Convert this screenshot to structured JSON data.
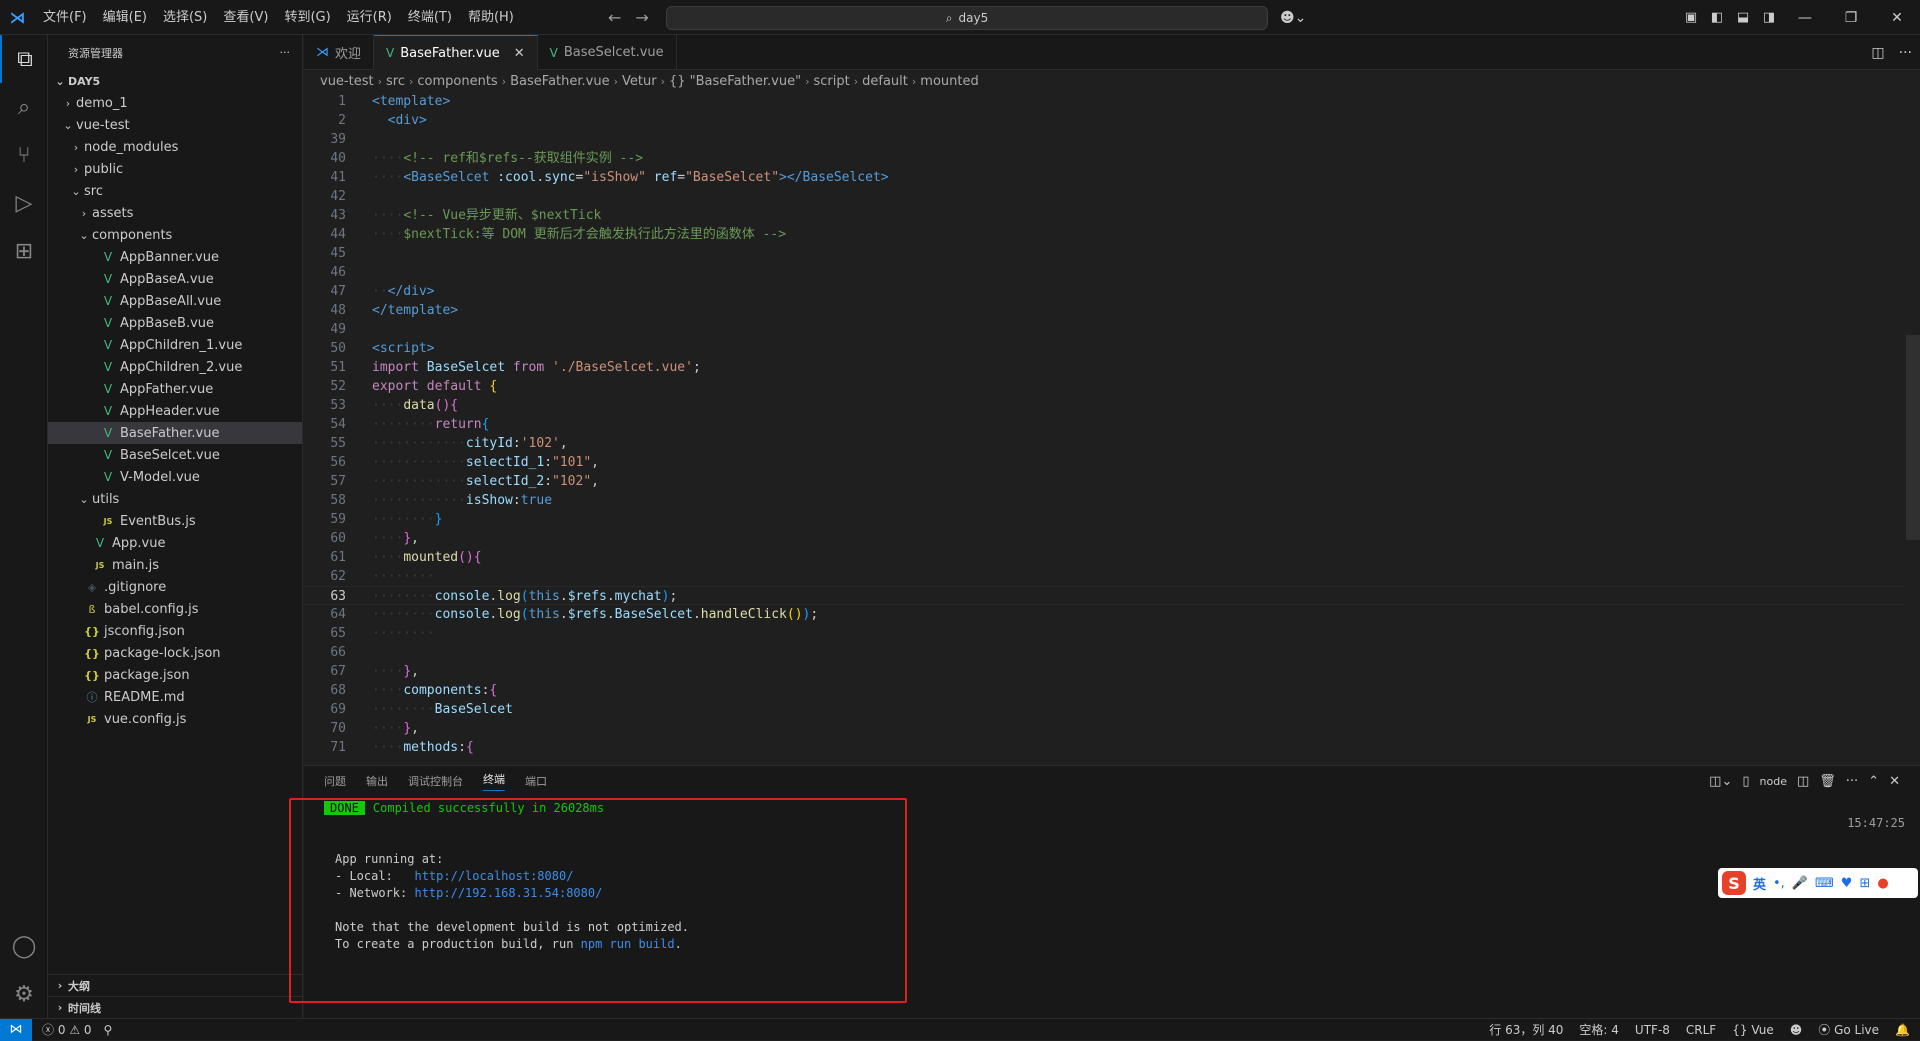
{
  "menu": [
    "文件(F)",
    "编辑(E)",
    "选择(S)",
    "查看(V)",
    "转到(G)",
    "运行(R)",
    "终端(T)",
    "帮助(H)"
  ],
  "search": {
    "text": "day5"
  },
  "sidebar": {
    "title": "资源管理器",
    "root": "DAY5",
    "tree": [
      {
        "label": "demo_1",
        "depth": 1,
        "chev": "›",
        "icon": ""
      },
      {
        "label": "vue-test",
        "depth": 1,
        "chev": "⌄",
        "icon": ""
      },
      {
        "label": "node_modules",
        "depth": 2,
        "chev": "›",
        "icon": ""
      },
      {
        "label": "public",
        "depth": 2,
        "chev": "›",
        "icon": ""
      },
      {
        "label": "src",
        "depth": 2,
        "chev": "⌄",
        "icon": ""
      },
      {
        "label": "assets",
        "depth": 3,
        "chev": "›",
        "icon": ""
      },
      {
        "label": "components",
        "depth": 3,
        "chev": "⌄",
        "icon": ""
      },
      {
        "label": "AppBanner.vue",
        "depth": 4,
        "chev": "",
        "icon": "vue"
      },
      {
        "label": "AppBaseA.vue",
        "depth": 4,
        "chev": "",
        "icon": "vue"
      },
      {
        "label": "AppBaseAll.vue",
        "depth": 4,
        "chev": "",
        "icon": "vue"
      },
      {
        "label": "AppBaseB.vue",
        "depth": 4,
        "chev": "",
        "icon": "vue"
      },
      {
        "label": "AppChildren_1.vue",
        "depth": 4,
        "chev": "",
        "icon": "vue"
      },
      {
        "label": "AppChildren_2.vue",
        "depth": 4,
        "chev": "",
        "icon": "vue"
      },
      {
        "label": "AppFather.vue",
        "depth": 4,
        "chev": "",
        "icon": "vue"
      },
      {
        "label": "AppHeader.vue",
        "depth": 4,
        "chev": "",
        "icon": "vue"
      },
      {
        "label": "BaseFather.vue",
        "depth": 4,
        "chev": "",
        "icon": "vue",
        "selected": true
      },
      {
        "label": "BaseSelcet.vue",
        "depth": 4,
        "chev": "",
        "icon": "vue"
      },
      {
        "label": "V-Model.vue",
        "depth": 4,
        "chev": "",
        "icon": "vue"
      },
      {
        "label": "utils",
        "depth": 3,
        "chev": "⌄",
        "icon": ""
      },
      {
        "label": "EventBus.js",
        "depth": 4,
        "chev": "",
        "icon": "js"
      },
      {
        "label": "App.vue",
        "depth": 3,
        "chev": "",
        "icon": "vue"
      },
      {
        "label": "main.js",
        "depth": 3,
        "chev": "",
        "icon": "js"
      },
      {
        "label": ".gitignore",
        "depth": 2,
        "chev": "",
        "icon": "git"
      },
      {
        "label": "babel.config.js",
        "depth": 2,
        "chev": "",
        "icon": "babel"
      },
      {
        "label": "jsconfig.json",
        "depth": 2,
        "chev": "",
        "icon": "json"
      },
      {
        "label": "package-lock.json",
        "depth": 2,
        "chev": "",
        "icon": "json"
      },
      {
        "label": "package.json",
        "depth": 2,
        "chev": "",
        "icon": "json"
      },
      {
        "label": "README.md",
        "depth": 2,
        "chev": "",
        "icon": "info"
      },
      {
        "label": "vue.config.js",
        "depth": 2,
        "chev": "",
        "icon": "js"
      }
    ],
    "sections": [
      "大纲",
      "时间线"
    ]
  },
  "tabs": [
    {
      "label": "欢迎",
      "icon": "vscode",
      "active": false
    },
    {
      "label": "BaseFather.vue",
      "icon": "vue",
      "active": true
    },
    {
      "label": "BaseSelcet.vue",
      "icon": "vue",
      "active": false
    }
  ],
  "breadcrumb": [
    "vue-test",
    "src",
    "components",
    "BaseFather.vue",
    "Vetur",
    "{} \"BaseFather.vue\"",
    "script",
    "default",
    "mounted"
  ],
  "code": [
    {
      "n": "1",
      "h": "<span class='tag'>&lt;template&gt;</span>"
    },
    {
      "n": "2",
      "h": "  <span class='tag'>&lt;div&gt;</span>"
    },
    {
      "n": "39",
      "h": ""
    },
    {
      "n": "40",
      "h": "<span class='ws'>····</span><span class='cmt'>&lt;!-- ref和$refs--获取组件实例 --&gt;</span>"
    },
    {
      "n": "41",
      "h": "<span class='ws'>····</span><span class='tag'>&lt;BaseSelcet</span> <span class='attr'>:cool.sync</span>=<span class='str'>\"isShow\"</span> <span class='attr'>ref</span>=<span class='str'>\"BaseSelcet\"</span><span class='tag'>&gt;&lt;/BaseSelcet&gt;</span>"
    },
    {
      "n": "42",
      "h": ""
    },
    {
      "n": "43",
      "h": "<span class='ws'>····</span><span class='cmt'>&lt;!-- Vue异步更新、$nextTick</span>"
    },
    {
      "n": "44",
      "h": "<span class='ws'>····</span><span class='cmt'>$nextTick:等 DOM 更新后才会触发执行此方法里的函数体 --&gt;</span>"
    },
    {
      "n": "45",
      "h": ""
    },
    {
      "n": "46",
      "h": ""
    },
    {
      "n": "47",
      "h": "<span class='ws'>··</span><span class='tag'>&lt;/div&gt;</span>"
    },
    {
      "n": "48",
      "h": "<span class='tag'>&lt;/template&gt;</span>"
    },
    {
      "n": "49",
      "h": ""
    },
    {
      "n": "50",
      "h": "<span class='tag'>&lt;script&gt;</span>"
    },
    {
      "n": "51",
      "h": "<span class='kw'>import</span> <span class='prop'>BaseSelcet</span> <span class='kw'>from</span> <span class='str'>'./BaseSelcet.vue'</span>;"
    },
    {
      "n": "52",
      "h": "<span class='kw'>export</span> <span class='kw'>default</span> <span class='br1'>{</span>"
    },
    {
      "n": "53",
      "h": "<span class='ws'>····</span><span class='fn'>data</span><span class='br2'>()</span><span class='br2'>{</span>"
    },
    {
      "n": "54",
      "h": "<span class='ws'>········</span><span class='kw'>return</span><span class='br3'>{</span>"
    },
    {
      "n": "55",
      "h": "<span class='ws'>············</span><span class='prop'>cityId</span>:<span class='str'>'102'</span>,"
    },
    {
      "n": "56",
      "h": "<span class='ws'>············</span><span class='prop'>selectId_1</span>:<span class='str'>\"101\"</span>,"
    },
    {
      "n": "57",
      "h": "<span class='ws'>············</span><span class='prop'>selectId_2</span>:<span class='str'>\"102\"</span>,"
    },
    {
      "n": "58",
      "h": "<span class='ws'>············</span><span class='prop'>isShow</span>:<span class='kw2'>true</span>"
    },
    {
      "n": "59",
      "h": "<span class='ws'>········</span><span class='br3'>}</span>"
    },
    {
      "n": "60",
      "h": "<span class='ws'>····</span><span class='br2'>}</span>,"
    },
    {
      "n": "61",
      "h": "<span class='ws'>····</span><span class='fn'>mounted</span><span class='br2'>()</span><span class='br2'>{</span>"
    },
    {
      "n": "62",
      "h": "<span class='ws'>········</span>"
    },
    {
      "n": "63",
      "h": "<span class='ws'>········</span><span class='prop'>console</span>.<span class='fn'>log</span><span class='br3'>(</span><span class='kw2'>this</span>.<span class='prop'>$refs</span>.<span class='prop'>mychat</span><span class='br3'>)</span>;",
      "cur": true
    },
    {
      "n": "64",
      "h": "<span class='ws'>········</span><span class='prop'>console</span>.<span class='fn'>log</span><span class='br3'>(</span><span class='kw2'>this</span>.<span class='prop'>$refs</span>.<span class='prop'>BaseSelcet</span>.<span class='fn'>handleClick</span><span class='br1'>()</span><span class='br3'>)</span>;"
    },
    {
      "n": "65",
      "h": "<span class='ws'>········</span>"
    },
    {
      "n": "66",
      "h": ""
    },
    {
      "n": "67",
      "h": "<span class='ws'>····</span><span class='br2'>}</span>,"
    },
    {
      "n": "68",
      "h": "<span class='ws'>····</span><span class='prop'>components</span>:<span class='br2'>{</span>"
    },
    {
      "n": "69",
      "h": "<span class='ws'>········</span><span class='prop'>BaseSelcet</span>"
    },
    {
      "n": "70",
      "h": "<span class='ws'>····</span><span class='br2'>}</span>,"
    },
    {
      "n": "71",
      "h": "<span class='ws'>····</span><span class='prop'>methods</span>:<span class='br2'>{</span>"
    }
  ],
  "panel": {
    "tabs": [
      "问题",
      "输出",
      "调试控制台",
      "终端",
      "端口"
    ],
    "active_tab": "终端",
    "terminal_name": "node",
    "time": "15:47:25",
    "done_badge": "DONE",
    "compiled": "Compiled successfully in 26028ms",
    "running": "App running at:",
    "local_label": "- Local:   ",
    "local_url": "http://localhost:8080/",
    "network_label": "- Network: ",
    "network_url": "http://192.168.31.54:8080/",
    "note1": "Note that the development build is not optimized.",
    "note2_a": "To create a production build, run ",
    "note2_cmd": "npm run build",
    "note2_b": "."
  },
  "ime": {
    "logo": "S",
    "lang": "英"
  },
  "status": {
    "errors": "0",
    "warnings": "0",
    "position": "行 63，列 40",
    "spaces": "空格: 4",
    "encoding": "UTF-8",
    "eol": "CRLF",
    "language": "Vue",
    "golive": "Go Live"
  }
}
